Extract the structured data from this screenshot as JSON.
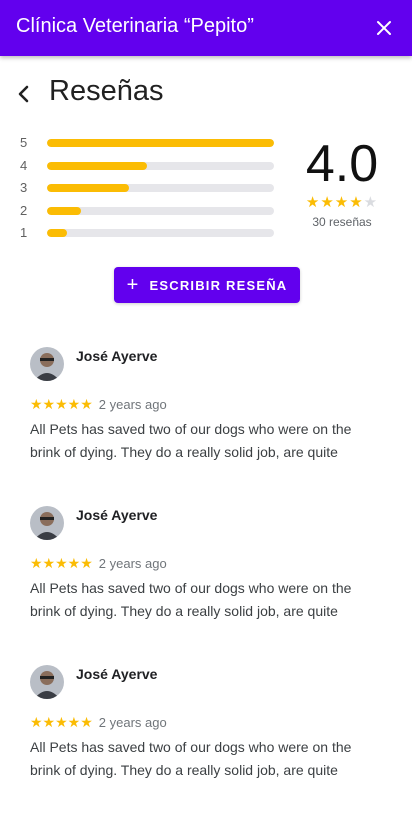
{
  "appbar": {
    "title": "Clínica Veterinaria “Pepito”",
    "close_icon": "close-icon",
    "background": "#6200ee"
  },
  "header": {
    "title": "Reseñas",
    "back_icon": "chevron-left-icon"
  },
  "ratings": {
    "distribution": [
      {
        "label": "5",
        "fraction": 1.0
      },
      {
        "label": "4",
        "fraction": 0.44
      },
      {
        "label": "3",
        "fraction": 0.36
      },
      {
        "label": "2",
        "fraction": 0.15
      },
      {
        "label": "1",
        "fraction": 0.09
      }
    ],
    "average": "4.0",
    "stars_filled": 4,
    "stars_total": 5,
    "count_text": "30 reseñas",
    "star_color": "#fbbc04"
  },
  "write_button": {
    "label": "ESCRIBIR RESEÑA",
    "icon": "plus-icon"
  },
  "reviews": [
    {
      "name": "José Ayerve",
      "stars": 5,
      "date": "2 years ago",
      "text": "All Pets has saved two of our dogs who were on the brink of dying. They do a really solid job, are quite"
    },
    {
      "name": "José Ayerve",
      "stars": 5,
      "date": "2 years ago",
      "text": "All Pets has saved two of our dogs who were on the brink of dying. They do a really solid job, are quite"
    },
    {
      "name": "José Ayerve",
      "stars": 5,
      "date": "2 years ago",
      "text": "All Pets has saved two of our dogs who were on the brink of dying. They do a really solid job, are quite"
    }
  ]
}
